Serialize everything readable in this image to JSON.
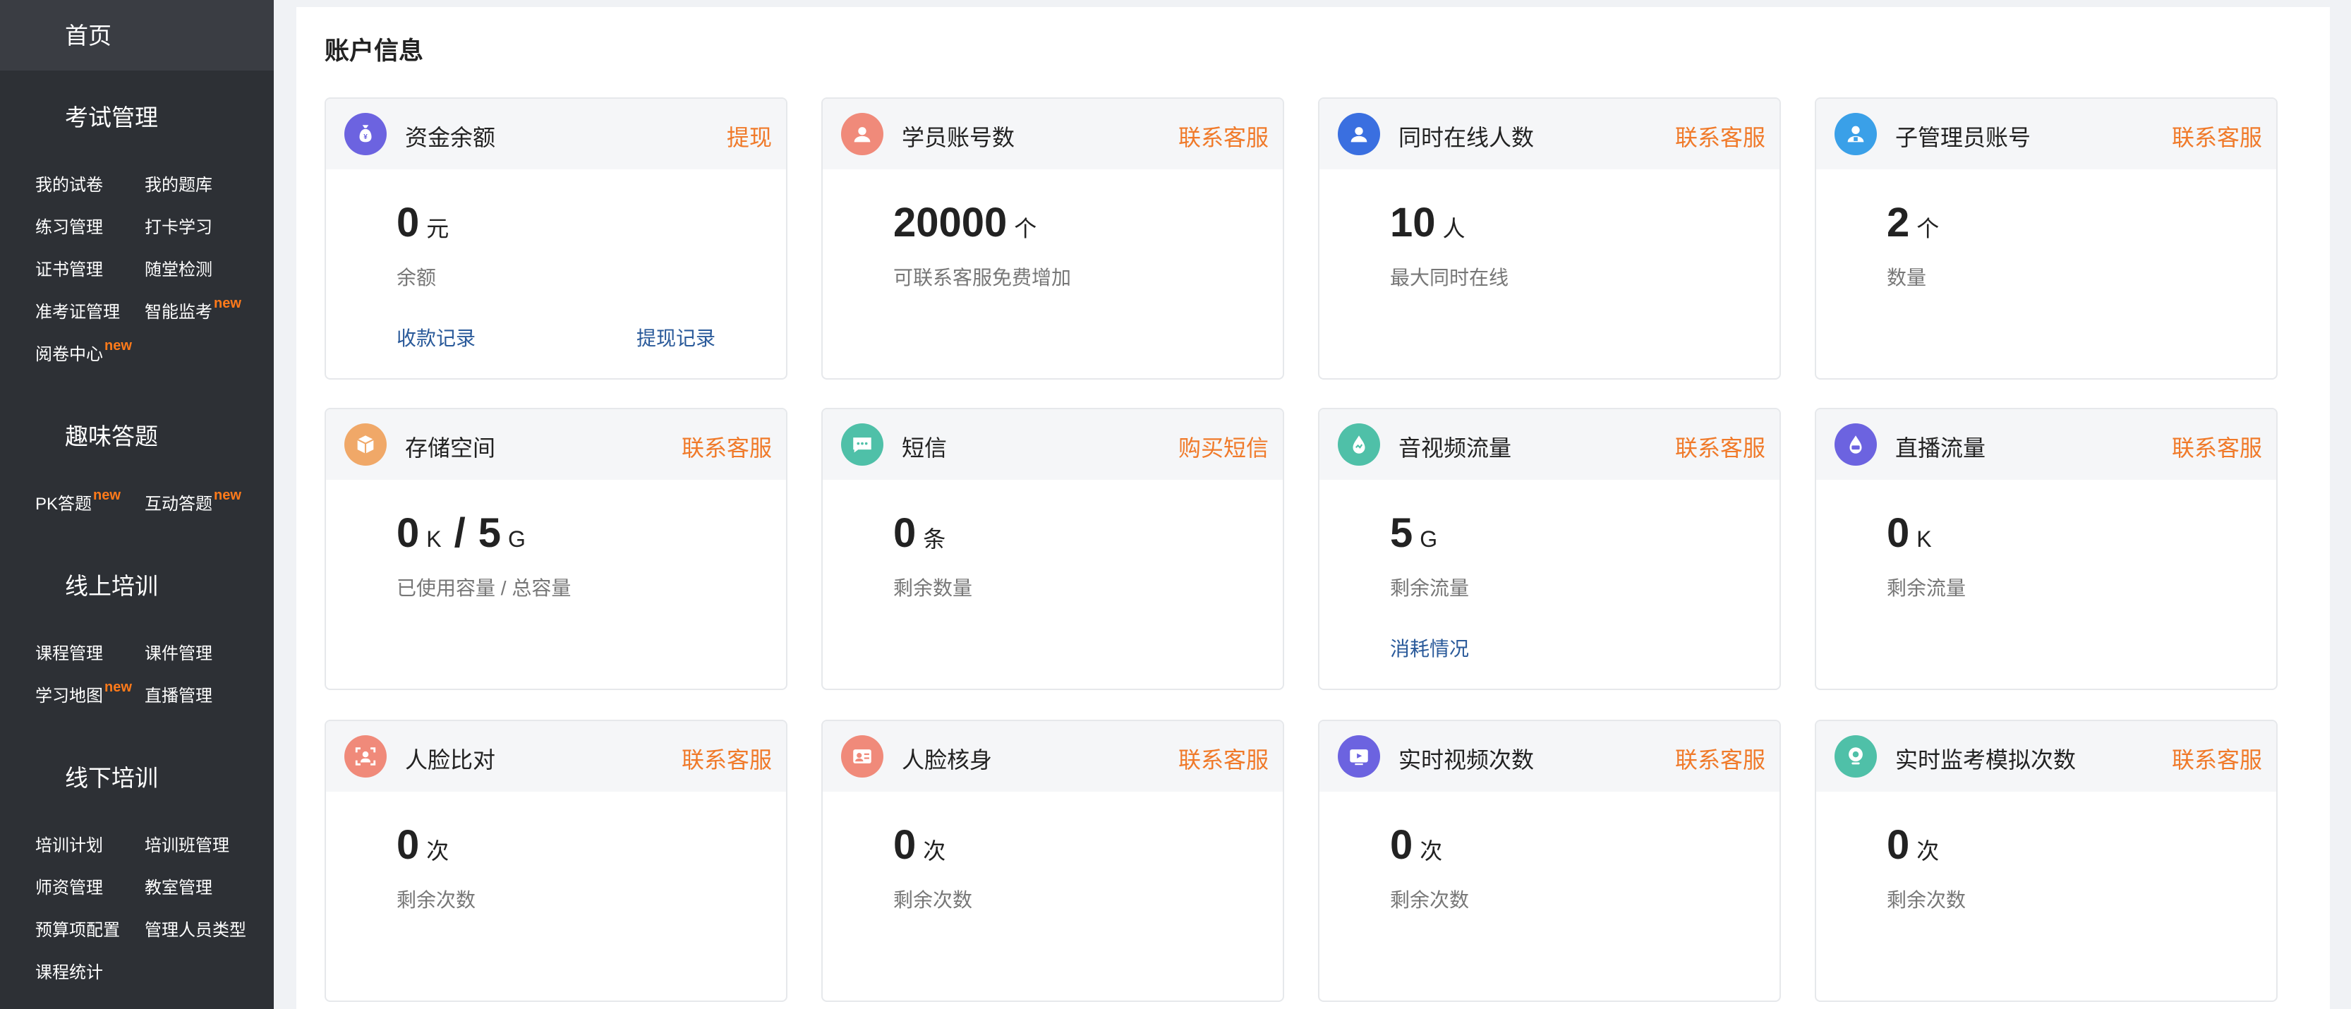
{
  "sidebar": {
    "home": "首页",
    "sections": [
      {
        "title": "考试管理",
        "items": [
          {
            "label": "我的试卷",
            "new": ""
          },
          {
            "label": "我的题库",
            "new": ""
          },
          {
            "label": "练习管理",
            "new": ""
          },
          {
            "label": "打卡学习",
            "new": ""
          },
          {
            "label": "证书管理",
            "new": ""
          },
          {
            "label": "随堂检测",
            "new": ""
          },
          {
            "label": "准考证管理",
            "new": ""
          },
          {
            "label": "智能监考",
            "new": "new"
          },
          {
            "label": "阅卷中心",
            "new": "new"
          }
        ]
      },
      {
        "title": "趣味答题",
        "items": [
          {
            "label": "PK答题",
            "new": "new"
          },
          {
            "label": "互动答题",
            "new": "new"
          }
        ]
      },
      {
        "title": "线上培训",
        "items": [
          {
            "label": "课程管理",
            "new": ""
          },
          {
            "label": "课件管理",
            "new": ""
          },
          {
            "label": "学习地图",
            "new": "new"
          },
          {
            "label": "直播管理",
            "new": ""
          }
        ]
      },
      {
        "title": "线下培训",
        "items": [
          {
            "label": "培训计划",
            "new": ""
          },
          {
            "label": "培训班管理",
            "new": ""
          },
          {
            "label": "师资管理",
            "new": ""
          },
          {
            "label": "教室管理",
            "new": ""
          },
          {
            "label": "预算项配置",
            "new": ""
          },
          {
            "label": "管理人员类型",
            "new": ""
          },
          {
            "label": "课程统计",
            "new": ""
          }
        ]
      }
    ]
  },
  "main": {
    "title": "账户信息",
    "cards": [
      {
        "title": "资金余额",
        "action": "提现",
        "value": "0",
        "unit": "元",
        "desc": "余额",
        "links": [
          "收款记录",
          "提现记录"
        ],
        "icon": "money-bag-icon",
        "color": "#6c63e0"
      },
      {
        "title": "学员账号数",
        "action": "联系客服",
        "value": "20000",
        "unit": "个",
        "desc": "可联系客服免费增加",
        "icon": "user-icon",
        "color": "#f08a7a"
      },
      {
        "title": "同时在线人数",
        "action": "联系客服",
        "value": "10",
        "unit": "人",
        "desc": "最大同时在线",
        "icon": "online-user-icon",
        "color": "#3a6fe0"
      },
      {
        "title": "子管理员账号",
        "action": "联系客服",
        "value": "2",
        "unit": "个",
        "desc": "数量",
        "icon": "admin-icon",
        "color": "#3aa0e8"
      },
      {
        "title": "存储空间",
        "action": "联系客服",
        "value": "0",
        "unit": "K",
        "value2": "5",
        "unit2": "G",
        "separator": "/",
        "desc": "已使用容量 / 总容量",
        "icon": "box-icon",
        "color": "#f0a868"
      },
      {
        "title": "短信",
        "action": "购买短信",
        "value": "0",
        "unit": "条",
        "desc": "剩余数量",
        "icon": "sms-icon",
        "color": "#4fc0a8"
      },
      {
        "title": "音视频流量",
        "action": "联系客服",
        "value": "5",
        "unit": "G",
        "desc": "剩余流量",
        "links": [
          "消耗情况"
        ],
        "icon": "traffic-icon",
        "color": "#4fc0a8"
      },
      {
        "title": "直播流量",
        "action": "联系客服",
        "value": "0",
        "unit": "K",
        "desc": "剩余流量",
        "icon": "live-icon",
        "color": "#6c63e0"
      },
      {
        "title": "人脸比对",
        "action": "联系客服",
        "value": "0",
        "unit": "次",
        "desc": "剩余次数",
        "icon": "face-compare-icon",
        "color": "#f08a7a"
      },
      {
        "title": "人脸核身",
        "action": "联系客服",
        "value": "0",
        "unit": "次",
        "desc": "剩余次数",
        "icon": "face-verify-icon",
        "color": "#f08a7a"
      },
      {
        "title": "实时视频次数",
        "action": "联系客服",
        "value": "0",
        "unit": "次",
        "desc": "剩余次数",
        "icon": "video-icon",
        "color": "#6c63e0"
      },
      {
        "title": "实时监考模拟次数",
        "action": "联系客服",
        "value": "0",
        "unit": "次",
        "desc": "剩余次数",
        "icon": "camera-icon",
        "color": "#4fc0a8"
      }
    ]
  }
}
